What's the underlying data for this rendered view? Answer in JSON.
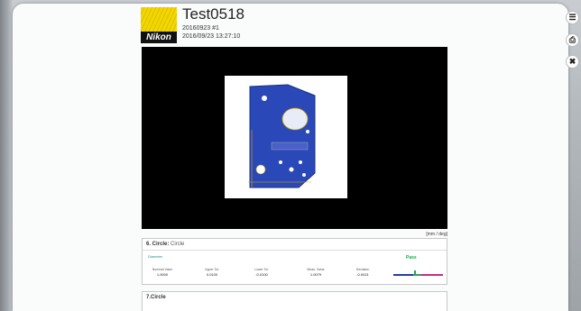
{
  "report": {
    "title": "Test0518",
    "subtitle_line1": "20160923 #1",
    "subtitle_line2": "2016/09/23 13:27:10",
    "logo_text": "Nikon"
  },
  "toolbar": {
    "list_icon": "list-icon",
    "print_icon": "print-icon",
    "close_icon": "close-icon"
  },
  "viewer": {
    "units": "[mm / deg]"
  },
  "feature6": {
    "title": "6. Circle:",
    "type": "Circle",
    "row_label": "Diameter",
    "status": "Pass",
    "metrics": [
      {
        "label": "Nominal Value",
        "value": "1.0000"
      },
      {
        "label": "Upper Tol.",
        "value": "0.0100"
      },
      {
        "label": "Lower Tol.",
        "value": "-0.0100"
      },
      {
        "label": "Meas. Value",
        "value": "1.0079"
      },
      {
        "label": "Deviation",
        "value": "-0.0021"
      }
    ]
  },
  "feature7": {
    "title": "7.Circle"
  },
  "colors": {
    "pass": "#1fa84a",
    "part_blue": "#2a48b8",
    "logo_yellow": "#f4d700"
  }
}
